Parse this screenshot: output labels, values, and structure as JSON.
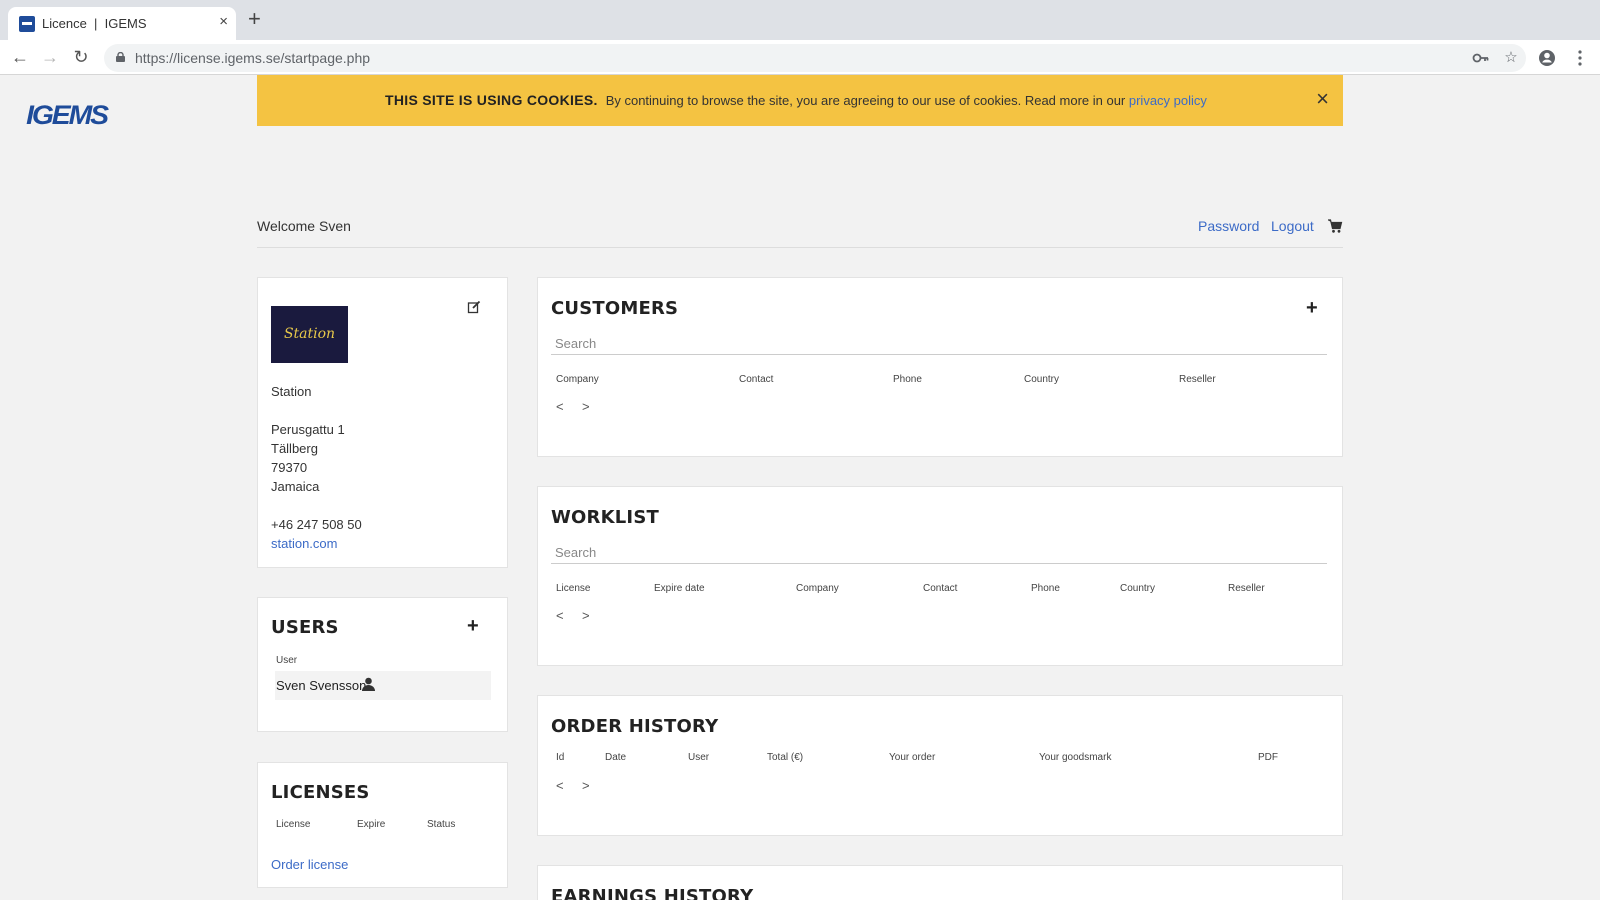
{
  "browser": {
    "tab_title": "Licence  |  IGEMS",
    "url_host": "https://license.igems.se",
    "url_path": "/startpage.php",
    "new_tab": "+",
    "close_tab": "×"
  },
  "brand": {
    "logo_text": "IGEMS",
    "color": "#1f4c9a"
  },
  "cookie_banner": {
    "title": "THIS SITE IS USING COOKIES.",
    "message": "By continuing to browse the site, you are agreeing to our use of cookies. Read more in our ",
    "link": "privacy policy",
    "close": "×",
    "color": "#f4c342"
  },
  "header": {
    "welcome": "Welcome Sven",
    "password_link": "Password",
    "logout_link": "Logout"
  },
  "company": {
    "logo_text": "Station",
    "name": "Station",
    "street": "Perusgattu 1",
    "city": "Tällberg",
    "zip": "79370",
    "country": "Jamaica",
    "phone": "+46 247 508 50",
    "website": "station.com"
  },
  "users": {
    "title": "USERS",
    "add": "+",
    "column": "User",
    "rows": [
      {
        "name": "Sven Svensson"
      }
    ]
  },
  "licenses": {
    "title": "LICENSES",
    "columns": [
      "License",
      "Expire",
      "Status"
    ],
    "order_link": "Order license"
  },
  "customers": {
    "title": "CUSTOMERS",
    "add": "+",
    "search_placeholder": "Search",
    "columns": [
      "Company",
      "Contact",
      "Phone",
      "Country",
      "Reseller"
    ],
    "prev": "<",
    "next": ">"
  },
  "worklist": {
    "title": "WORKLIST",
    "search_placeholder": "Search",
    "columns": [
      "License",
      "Expire date",
      "Company",
      "Contact",
      "Phone",
      "Country",
      "Reseller"
    ],
    "prev": "<",
    "next": ">"
  },
  "order_history": {
    "title": "ORDER HISTORY",
    "columns": [
      "Id",
      "Date",
      "User",
      "Total (€)",
      "Your order",
      "Your goodsmark",
      "PDF"
    ],
    "prev": "<",
    "next": ">"
  },
  "earnings_history": {
    "title": "EARNINGS HISTORY"
  },
  "colors": {
    "link": "#3c6bc7",
    "background": "#f2f2f2"
  }
}
